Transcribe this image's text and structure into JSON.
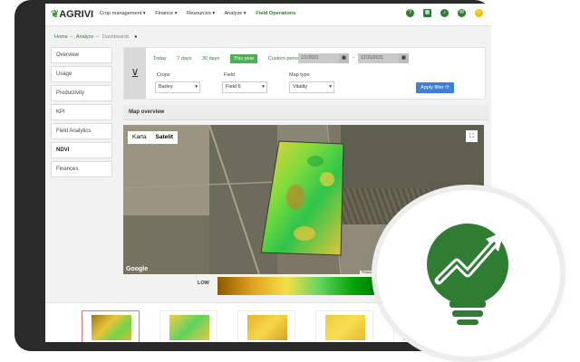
{
  "app": {
    "brand": "AGRIVI"
  },
  "nav": {
    "items": [
      "Crop management ▾",
      "Finance ▾",
      "Resources ▾",
      "Analyze ▾",
      "Field Operations"
    ]
  },
  "breadcrumb": {
    "home": "Home",
    "analyze": "Analyze",
    "current": "Dashboards"
  },
  "sidebar": {
    "items": [
      "Overview",
      "Usage",
      "Productivity",
      "KPI",
      "Field Analytics",
      "NDVI",
      "Finances"
    ],
    "active": "NDVI"
  },
  "filters": {
    "periods": [
      "Today",
      "7 days",
      "30 days",
      "This year",
      "Custom period"
    ],
    "selected_period": "This year",
    "date_from": "1/1/2021",
    "date_to": "12/31/2021",
    "crops_label": "Crops",
    "crops_value": "Barley",
    "field_label": "Field",
    "field_value": "Field 6",
    "maptype_label": "Map type",
    "maptype_value": "Vitality",
    "apply_label": "Apply filter"
  },
  "map": {
    "header": "Map overview",
    "toggle": [
      "Karta",
      "Satelit"
    ],
    "active_toggle": "Satelit",
    "google": "Google",
    "attribution": "Podaci karte ©2021 Snimci prikaz ©2021 , CNES / Airbus, Maxar Technologies   200 m",
    "legend_low": "LOW"
  },
  "colors": {
    "brand_green": "#2e7d32",
    "accent_green": "#4caf50",
    "apply_blue": "#3f7fd6",
    "thumb_selected": "#e57373"
  }
}
